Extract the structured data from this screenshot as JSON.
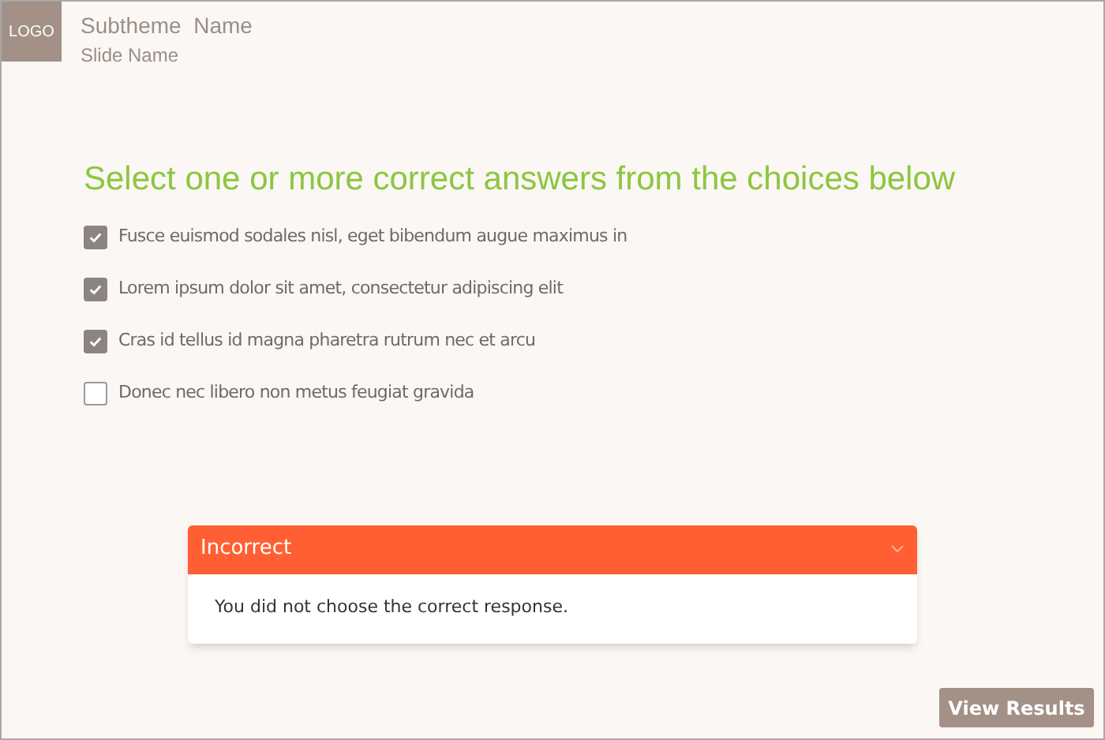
{
  "header": {
    "logo": "LOGO",
    "subtheme": "Subtheme  Name",
    "slide": "Slide Name"
  },
  "question": "Select one or more correct answers from the choices below",
  "choices": [
    {
      "label": "Fusce euismod sodales nisl, eget bibendum augue maximus in",
      "checked": true
    },
    {
      "label": "Lorem ipsum dolor sit amet, consectetur adipiscing elit",
      "checked": true
    },
    {
      "label": "Cras id tellus id magna pharetra rutrum nec et arcu",
      "checked": true
    },
    {
      "label": "Donec nec libero non metus feugiat gravida",
      "checked": false
    }
  ],
  "feedback": {
    "title": "Incorrect",
    "expanded": true,
    "message": "You did not choose the correct response."
  },
  "button": "View Results"
}
